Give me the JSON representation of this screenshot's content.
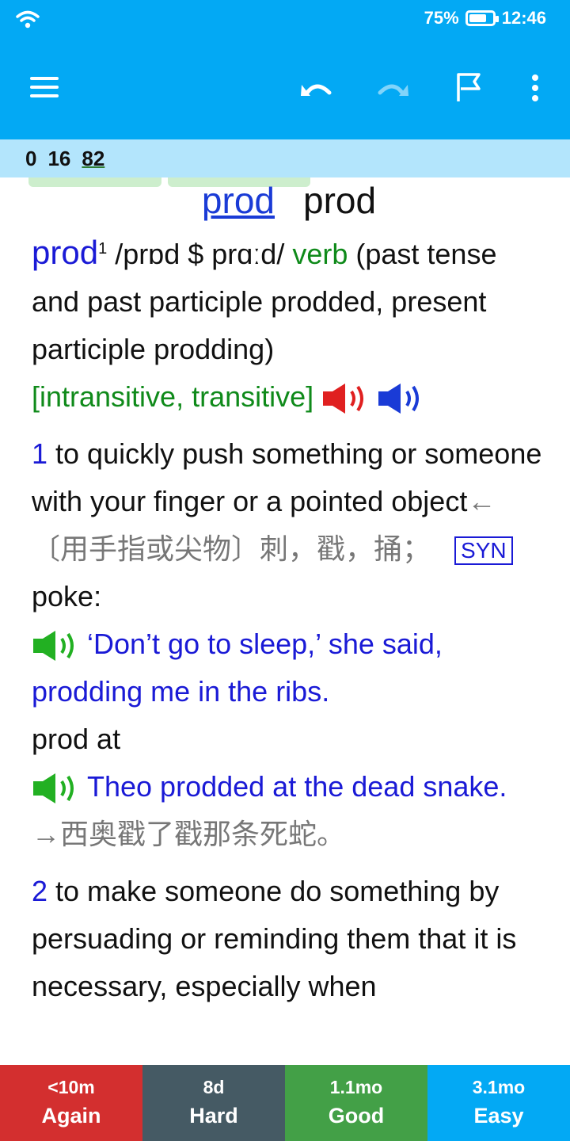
{
  "status": {
    "battery": "75%",
    "battery_level": 0.75,
    "time": "12:46"
  },
  "toolbar": {
    "colors": {
      "appbar": "#03A9F4"
    },
    "icons": [
      "menu-icon",
      "undo-icon",
      "redo-icon",
      "flag-icon",
      "more-vert-icon"
    ]
  },
  "counts": {
    "new": "0",
    "learning": "16",
    "review": "82"
  },
  "card": {
    "front_link": "prod",
    "front_plain": "prod",
    "headword": "prod",
    "homograph": "1",
    "pron": " /prɒd $ prɑːd/ ",
    "pos": "verb",
    "inflections": " (past tense and past participle prodded, present participle prodding)",
    "grammar": "[intransitive, transitive]",
    "s1_num": "1",
    "s1_def": " to quickly push something or someone with your finger or a pointed object",
    "s1_cn": "←〔用手指或尖物〕刺，戳，捅；",
    "syn_label": "SYN",
    "syn_word": "poke:",
    "ex1": "‘Don’t go to sleep,’ she said, prodding me in the ribs.",
    "phrase": "prod at",
    "ex2": "Theo prodded at the dead snake.",
    "ex2_cn": "→西奥戳了戳那条死蛇。",
    "s2_num": "2",
    "s2_def": " to make someone do something by persuading or reminding them that it is necessary, especially when"
  },
  "answers": [
    {
      "interval": "<10m",
      "label": "Again",
      "color": "#D32F2F"
    },
    {
      "interval": "8d",
      "label": "Hard",
      "color": "#455A64"
    },
    {
      "interval": "1.1mo",
      "label": "Good",
      "color": "#43A047"
    },
    {
      "interval": "3.1mo",
      "label": "Easy",
      "color": "#03A9F4"
    }
  ]
}
